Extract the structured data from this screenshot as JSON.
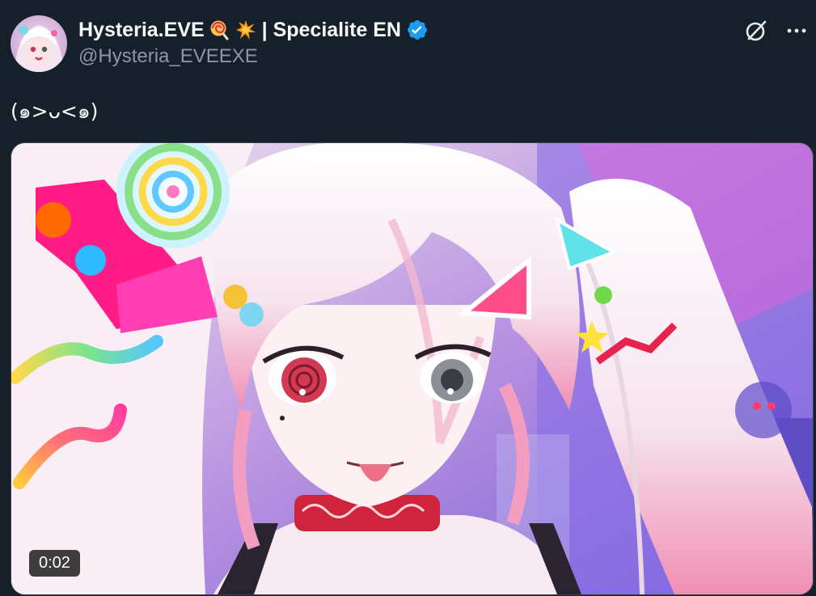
{
  "author": {
    "display_name": "Hysteria.EVE",
    "name_suffix": "| Specialite EN",
    "handle": "@Hysteria_EVEEXE",
    "verified": true,
    "emojis": [
      "lollipop-emoji",
      "collision-emoji"
    ]
  },
  "post": {
    "text": "(๑>ᴗ<๑)"
  },
  "actions": {
    "grok_icon": "grok-icon",
    "more_icon": "more-options-icon"
  },
  "media": {
    "type": "video",
    "duration": "0:02"
  },
  "colors": {
    "background": "#15202b",
    "verified_blue": "#1d9bf0",
    "secondary_text": "#8b98a5"
  }
}
